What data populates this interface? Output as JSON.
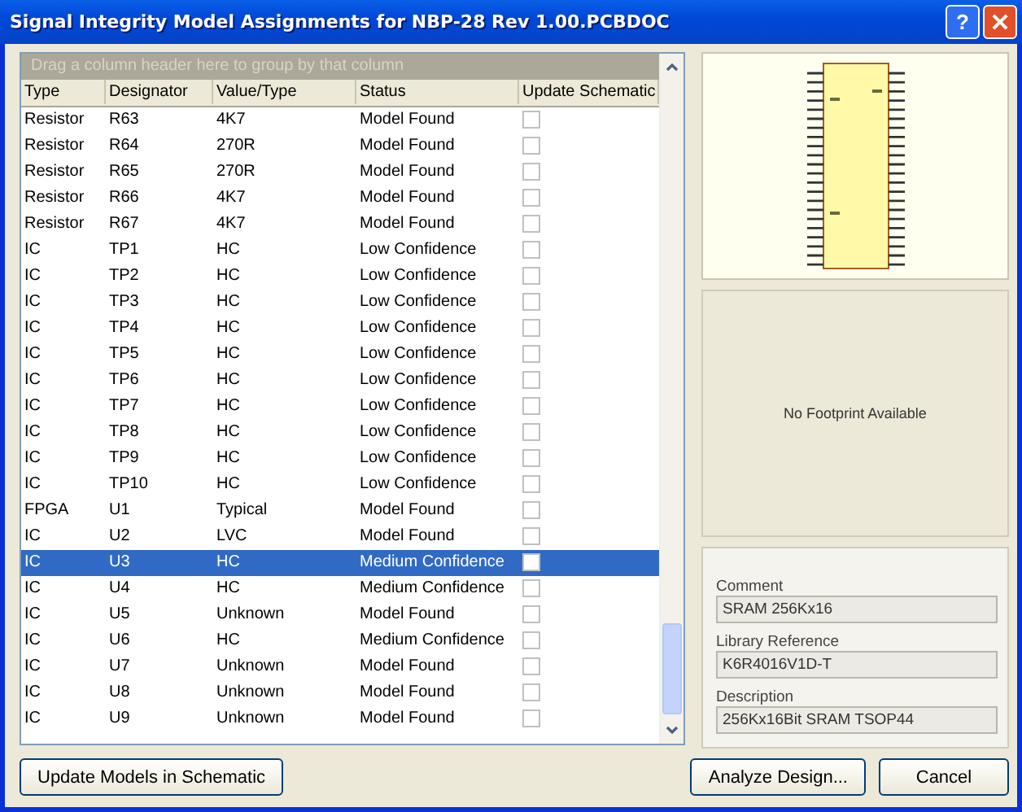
{
  "window": {
    "title": "Signal Integrity Model Assignments for NBP-28 Rev 1.00.PCBDOC",
    "help_button": "?"
  },
  "grid": {
    "group_hint": "Drag a column header here to group by that column",
    "columns": [
      "Type",
      "Designator",
      "Value/Type",
      "Status",
      "Update Schematic"
    ],
    "rows": [
      {
        "type": "Resistor",
        "designator": "R63",
        "value": "4K7",
        "status": "Model Found",
        "checked": false,
        "selected": false
      },
      {
        "type": "Resistor",
        "designator": "R64",
        "value": "270R",
        "status": "Model Found",
        "checked": false,
        "selected": false
      },
      {
        "type": "Resistor",
        "designator": "R65",
        "value": "270R",
        "status": "Model Found",
        "checked": false,
        "selected": false
      },
      {
        "type": "Resistor",
        "designator": "R66",
        "value": "4K7",
        "status": "Model Found",
        "checked": false,
        "selected": false
      },
      {
        "type": "Resistor",
        "designator": "R67",
        "value": "4K7",
        "status": "Model Found",
        "checked": false,
        "selected": false
      },
      {
        "type": "IC",
        "designator": "TP1",
        "value": "HC",
        "status": "Low Confidence",
        "checked": false,
        "selected": false
      },
      {
        "type": "IC",
        "designator": "TP2",
        "value": "HC",
        "status": "Low Confidence",
        "checked": false,
        "selected": false
      },
      {
        "type": "IC",
        "designator": "TP3",
        "value": "HC",
        "status": "Low Confidence",
        "checked": false,
        "selected": false
      },
      {
        "type": "IC",
        "designator": "TP4",
        "value": "HC",
        "status": "Low Confidence",
        "checked": false,
        "selected": false
      },
      {
        "type": "IC",
        "designator": "TP5",
        "value": "HC",
        "status": "Low Confidence",
        "checked": false,
        "selected": false
      },
      {
        "type": "IC",
        "designator": "TP6",
        "value": "HC",
        "status": "Low Confidence",
        "checked": false,
        "selected": false
      },
      {
        "type": "IC",
        "designator": "TP7",
        "value": "HC",
        "status": "Low Confidence",
        "checked": false,
        "selected": false
      },
      {
        "type": "IC",
        "designator": "TP8",
        "value": "HC",
        "status": "Low Confidence",
        "checked": false,
        "selected": false
      },
      {
        "type": "IC",
        "designator": "TP9",
        "value": "HC",
        "status": "Low Confidence",
        "checked": false,
        "selected": false
      },
      {
        "type": "IC",
        "designator": "TP10",
        "value": "HC",
        "status": "Low Confidence",
        "checked": false,
        "selected": false
      },
      {
        "type": "FPGA",
        "designator": "U1",
        "value": "Typical",
        "status": "Model Found",
        "checked": false,
        "selected": false
      },
      {
        "type": "IC",
        "designator": "U2",
        "value": "LVC",
        "status": "Model Found",
        "checked": false,
        "selected": false
      },
      {
        "type": "IC",
        "designator": "U3",
        "value": "HC",
        "status": "Medium Confidence",
        "checked": false,
        "selected": true
      },
      {
        "type": "IC",
        "designator": "U4",
        "value": "HC",
        "status": "Medium Confidence",
        "checked": false,
        "selected": false
      },
      {
        "type": "IC",
        "designator": "U5",
        "value": "Unknown",
        "status": "Model Found",
        "checked": false,
        "selected": false
      },
      {
        "type": "IC",
        "designator": "U6",
        "value": "HC",
        "status": "Medium Confidence",
        "checked": false,
        "selected": false
      },
      {
        "type": "IC",
        "designator": "U7",
        "value": "Unknown",
        "status": "Model Found",
        "checked": false,
        "selected": false
      },
      {
        "type": "IC",
        "designator": "U8",
        "value": "Unknown",
        "status": "Model Found",
        "checked": false,
        "selected": false
      },
      {
        "type": "IC",
        "designator": "U9",
        "value": "Unknown",
        "status": "Model Found",
        "checked": false,
        "selected": false
      }
    ]
  },
  "footprint": {
    "message": "No Footprint Available"
  },
  "details": [
    {
      "label": "Comment",
      "value": "SRAM 256Kx16"
    },
    {
      "label": "Library Reference",
      "value": "K6R4016V1D-T"
    },
    {
      "label": "Description",
      "value": "256Kx16Bit SRAM TSOP44"
    }
  ],
  "buttons": {
    "left": "Update Models in Schematic",
    "analyze": "Analyze Design...",
    "cancel": "Cancel"
  }
}
